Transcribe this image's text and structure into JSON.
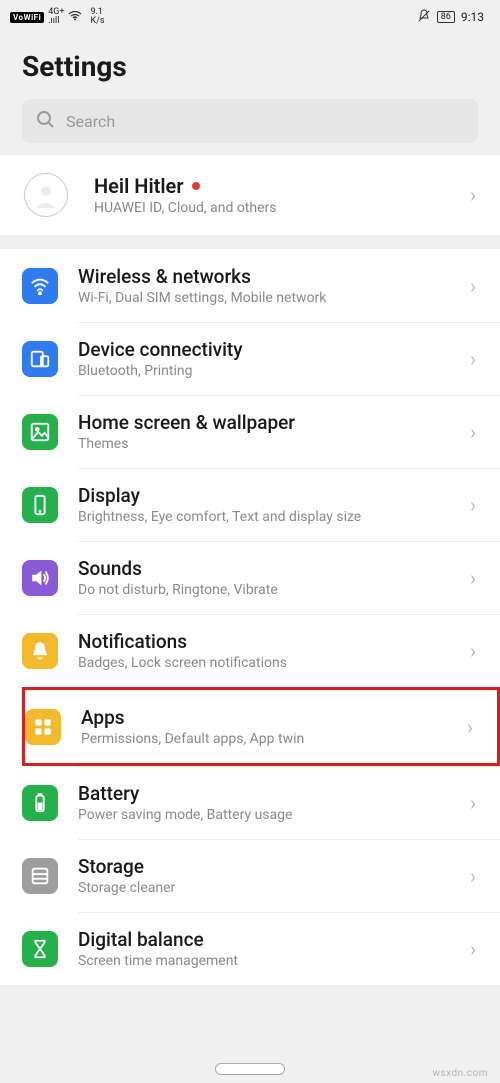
{
  "status": {
    "vowifi": "VoWiFi",
    "net": "4G+",
    "speed_top": "9.1",
    "speed_bot": "K/s",
    "battery": "86",
    "time": "9:13"
  },
  "page_title": "Settings",
  "search": {
    "placeholder": "Search"
  },
  "account": {
    "name": "Heil Hitler",
    "sub": "HUAWEI ID, Cloud, and others"
  },
  "items": [
    {
      "key": "wireless",
      "title": "Wireless & networks",
      "sub": "Wi-Fi, Dual SIM settings, Mobile network",
      "icon": "wifi",
      "color": "c-blue"
    },
    {
      "key": "device-conn",
      "title": "Device connectivity",
      "sub": "Bluetooth, Printing",
      "icon": "devices",
      "color": "c-blue"
    },
    {
      "key": "home-wall",
      "title": "Home screen & wallpaper",
      "sub": "Themes",
      "icon": "image",
      "color": "c-green"
    },
    {
      "key": "display",
      "title": "Display",
      "sub": "Brightness, Eye comfort, Text and display size",
      "icon": "phone",
      "color": "c-green"
    },
    {
      "key": "sounds",
      "title": "Sounds",
      "sub": "Do not disturb, Ringtone, Vibrate",
      "icon": "sound",
      "color": "c-purple"
    },
    {
      "key": "notifications",
      "title": "Notifications",
      "sub": "Badges, Lock screen notifications",
      "icon": "bell",
      "color": "c-yellow"
    },
    {
      "key": "apps",
      "title": "Apps",
      "sub": "Permissions, Default apps, App twin",
      "icon": "apps",
      "color": "c-orange",
      "highlight": true
    },
    {
      "key": "battery",
      "title": "Battery",
      "sub": "Power saving mode, Battery usage",
      "icon": "battery",
      "color": "c-green"
    },
    {
      "key": "storage",
      "title": "Storage",
      "sub": "Storage cleaner",
      "icon": "storage",
      "color": "c-grey"
    },
    {
      "key": "digital",
      "title": "Digital balance",
      "sub": "Screen time management",
      "icon": "hourglass",
      "color": "c-green"
    }
  ],
  "watermark": "wsxdn.com"
}
